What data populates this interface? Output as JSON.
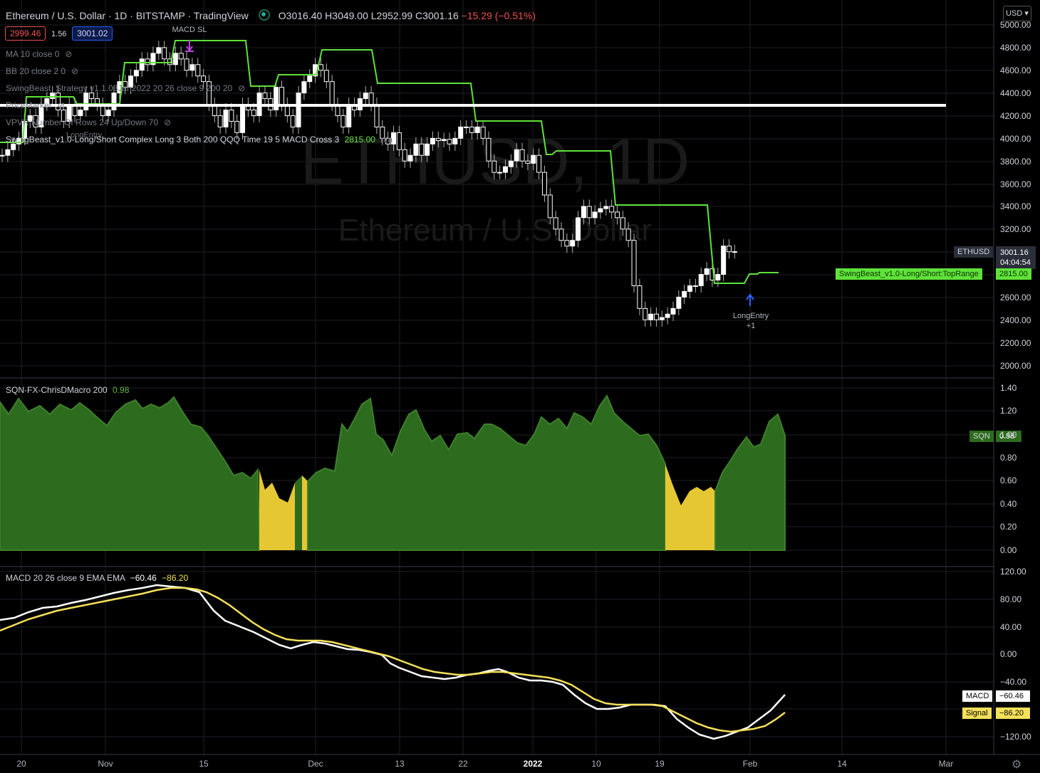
{
  "header": {
    "symbol_line": "Ethereum / U.S. Dollar · 1D · BITSTAMP · TradingView",
    "ohlc": "O3016.40  H3049.00  L2952.99  C3001.16",
    "change": "−15.29 (−0.51%)",
    "bid": "2999.46",
    "spread": "1.56",
    "ask": "3001.02"
  },
  "indicators": [
    {
      "label": "MA 10 close 0"
    },
    {
      "label": "BB 20 close 2 0"
    },
    {
      "label": "SwingBeast_Strategy v1.1.03Jan2022 20 26 close 9 200 20"
    },
    {
      "label": "PriceMarker"
    },
    {
      "label": "VPVR Number Of Rows 24 Up/Down 70"
    }
  ],
  "strategy_line": {
    "label": "SwingBeast_v1.0-Long/Short Complex Long 3 Both 200 QQQ Time 19 5 MACD Cross 3",
    "value": "2815.00",
    "suffix": "n/a"
  },
  "watermark": {
    "big": "ETHUSD, 1D",
    "small": "Ethereum / U.S. Dollar"
  },
  "annotations": {
    "macd_sl": "MACD SL",
    "long_entry": "LongEntry",
    "long_entry_count": "+1",
    "long_entry_old": "LongEntry"
  },
  "currency": "USD",
  "price_axis": [
    "5000.00",
    "4800.00",
    "4600.00",
    "4400.00",
    "4200.00",
    "4000.00",
    "3800.00",
    "3600.00",
    "3400.00",
    "3200.00",
    "2600.00",
    "2400.00",
    "2200.00",
    "2000.00"
  ],
  "price_tags": {
    "symbol": "ETHUSD",
    "last": "3001.16",
    "countdown": "04:04:54",
    "range_label": "SwingBeast_v1.0-Long/Short:TopRange",
    "range_value": "2815.00"
  },
  "sqn": {
    "title": "SQN-FX-ChrisDMacro 200",
    "value": "0.98",
    "tag": "SQN",
    "axis": [
      "1.40",
      "1.20",
      "1.00",
      "0.80",
      "0.60",
      "0.40",
      "0.20",
      "0.00"
    ]
  },
  "macd": {
    "title": "MACD 20 26 close 9 EMA EMA",
    "macd_value": "−60.46",
    "signal_value": "−86.20",
    "macd_tag": "MACD",
    "signal_tag": "Signal",
    "macd_tag_value": "−60.46",
    "signal_tag_value": "−86.20",
    "axis": [
      "120.00",
      "80.00",
      "40.00",
      "0.00",
      "−40.00",
      "−120.00"
    ]
  },
  "time_axis": [
    "20",
    "Nov",
    "15",
    "Dec",
    "13",
    "22",
    "2022",
    "10",
    "19",
    "Feb",
    "14",
    "Mar"
  ],
  "colors": {
    "green_line": "#5fe23a",
    "sqn_green": "#2d6b1e",
    "sqn_yellow": "#e5c733",
    "signal": "#f5e05a",
    "bid": "#ef5350",
    "ask": "#2962ff"
  }
}
